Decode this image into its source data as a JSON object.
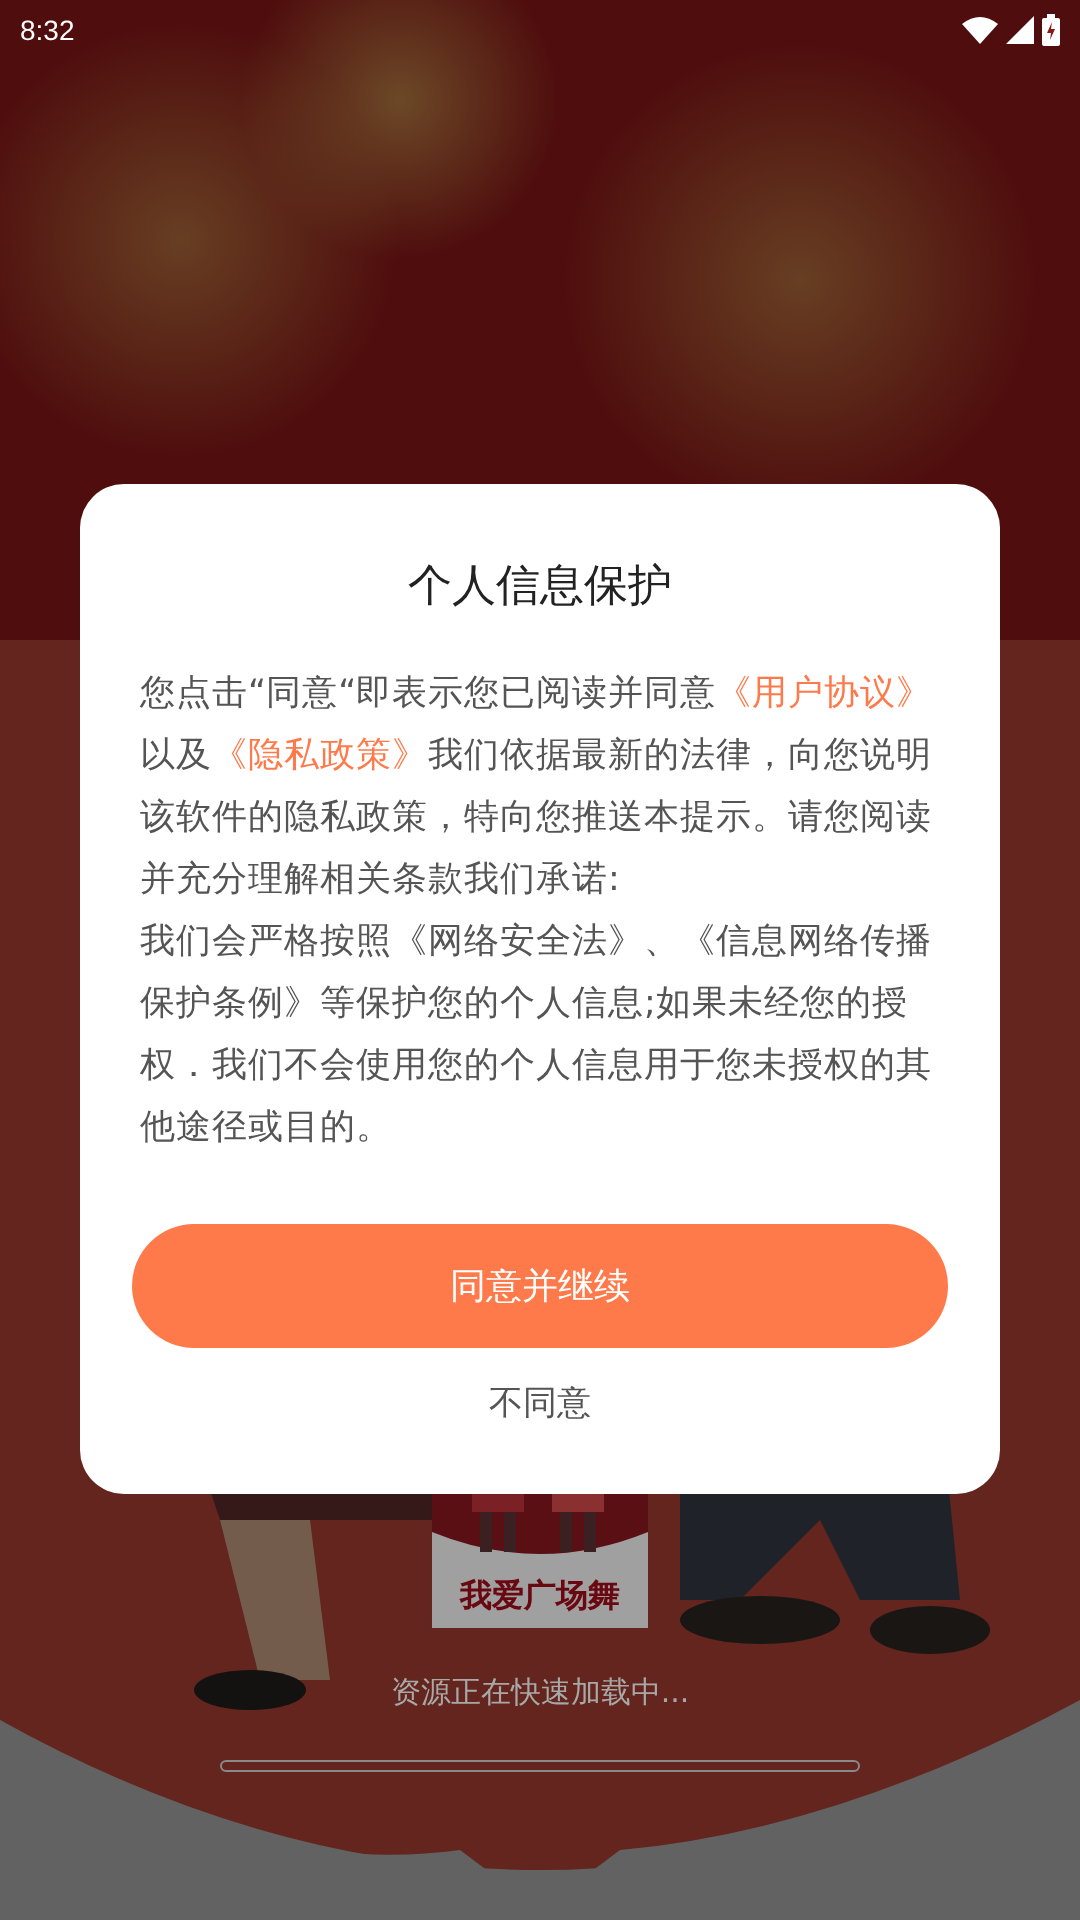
{
  "status_bar": {
    "time": "8:32"
  },
  "loading": {
    "logo_text": "我爱广场舞",
    "message": "资源正在快速加载中...",
    "track": true
  },
  "dialog": {
    "title": "个人信息保护",
    "paragraphs": [
      [
        {
          "text": "您点击“同意“即表示您已阅读并同意",
          "link": false
        },
        {
          "text": "《用户协议》",
          "link": true
        },
        {
          "text": "以及",
          "link": false
        },
        {
          "text": "《隐私政策》",
          "link": true
        },
        {
          "text": "我们依据最新的法律，向您说明该软件的隐私政策，特向您推送本提示。请您阅读并充分理解相关条款我们承诺:",
          "link": false
        }
      ],
      [
        {
          "text": "我们会严格按照《网络安全法》、《信息网络传播保护条例》等保护您的个人信息;如果未经您的授权．我们不会使用您的个人信息用于您未授权的其他途径或目的。",
          "link": false
        }
      ]
    ],
    "agree_button": "同意并继续",
    "decline_button": "不同意"
  }
}
